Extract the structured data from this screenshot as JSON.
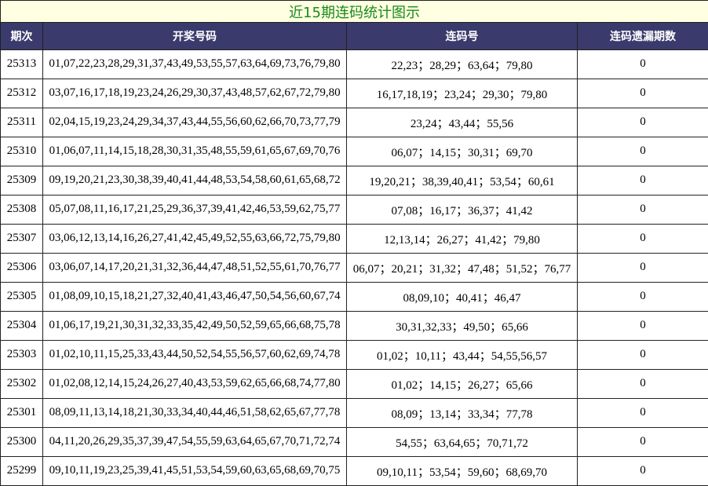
{
  "title": "近15期连码统计图示",
  "columns": [
    "期次",
    "开奖号码",
    "连码号",
    "连码遗漏期数"
  ],
  "rows": [
    {
      "issue": "25313",
      "draw": "01,07,22,23,28,29,31,37,43,49,53,55,57,63,64,69,73,76,79,80",
      "consec": "22,23；28,29；63,64；79,80",
      "miss": "0"
    },
    {
      "issue": "25312",
      "draw": "03,07,16,17,18,19,23,24,26,29,30,37,43,48,57,62,67,72,79,80",
      "consec": "16,17,18,19；23,24；29,30；79,80",
      "miss": "0"
    },
    {
      "issue": "25311",
      "draw": "02,04,15,19,23,24,29,34,37,43,44,55,56,60,62,66,70,73,77,79",
      "consec": "23,24；43,44；55,56",
      "miss": "0"
    },
    {
      "issue": "25310",
      "draw": "01,06,07,11,14,15,18,28,30,31,35,48,55,59,61,65,67,69,70,76",
      "consec": "06,07；14,15；30,31；69,70",
      "miss": "0"
    },
    {
      "issue": "25309",
      "draw": "09,19,20,21,23,30,38,39,40,41,44,48,53,54,58,60,61,65,68,72",
      "consec": "19,20,21；38,39,40,41；53,54；60,61",
      "miss": "0"
    },
    {
      "issue": "25308",
      "draw": "05,07,08,11,16,17,21,25,29,36,37,39,41,42,46,53,59,62,75,77",
      "consec": "07,08；16,17；36,37；41,42",
      "miss": "0"
    },
    {
      "issue": "25307",
      "draw": "03,06,12,13,14,16,26,27,41,42,45,49,52,55,63,66,72,75,79,80",
      "consec": "12,13,14；26,27；41,42；79,80",
      "miss": "0"
    },
    {
      "issue": "25306",
      "draw": "03,06,07,14,17,20,21,31,32,36,44,47,48,51,52,55,61,70,76,77",
      "consec": "06,07；20,21；31,32；47,48；51,52；76,77",
      "miss": "0"
    },
    {
      "issue": "25305",
      "draw": "01,08,09,10,15,18,21,27,32,40,41,43,46,47,50,54,56,60,67,74",
      "consec": "08,09,10；40,41；46,47",
      "miss": "0"
    },
    {
      "issue": "25304",
      "draw": "01,06,17,19,21,30,31,32,33,35,42,49,50,52,59,65,66,68,75,78",
      "consec": "30,31,32,33；49,50；65,66",
      "miss": "0"
    },
    {
      "issue": "25303",
      "draw": "01,02,10,11,15,25,33,43,44,50,52,54,55,56,57,60,62,69,74,78",
      "consec": "01,02；10,11；43,44；54,55,56,57",
      "miss": "0"
    },
    {
      "issue": "25302",
      "draw": "01,02,08,12,14,15,24,26,27,40,43,53,59,62,65,66,68,74,77,80",
      "consec": "01,02；14,15；26,27；65,66",
      "miss": "0"
    },
    {
      "issue": "25301",
      "draw": "08,09,11,13,14,18,21,30,33,34,40,44,46,51,58,62,65,67,77,78",
      "consec": "08,09；13,14；33,34；77,78",
      "miss": "0"
    },
    {
      "issue": "25300",
      "draw": "04,11,20,26,29,35,37,39,47,54,55,59,63,64,65,67,70,71,72,74",
      "consec": "54,55；63,64,65；70,71,72",
      "miss": "0"
    },
    {
      "issue": "25299",
      "draw": "09,10,11,19,23,25,39,41,45,51,53,54,59,60,63,65,68,69,70,75",
      "consec": "09,10,11；53,54；59,60；68,69,70",
      "miss": "0"
    }
  ],
  "colors": {
    "title_bg": "#ffffe1",
    "title_text": "#1a8a1a",
    "header_bg": "#3b3a6c",
    "header_text": "#ffffff"
  }
}
